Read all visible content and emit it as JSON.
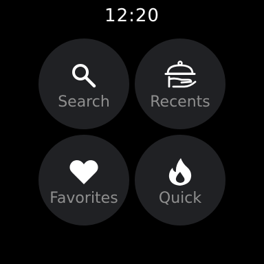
{
  "status": {
    "time": "12:20"
  },
  "menu": {
    "items": [
      {
        "label": "Search",
        "icon": "search-icon"
      },
      {
        "label": "Recents",
        "icon": "serving-cloche-icon"
      },
      {
        "label": "Favorites",
        "icon": "heart-icon"
      },
      {
        "label": "Quick",
        "icon": "flame-icon"
      }
    ]
  },
  "colors": {
    "background": "#000000",
    "tile": "#202124",
    "label": "#8f8f8f",
    "icon": "#ffffff"
  }
}
